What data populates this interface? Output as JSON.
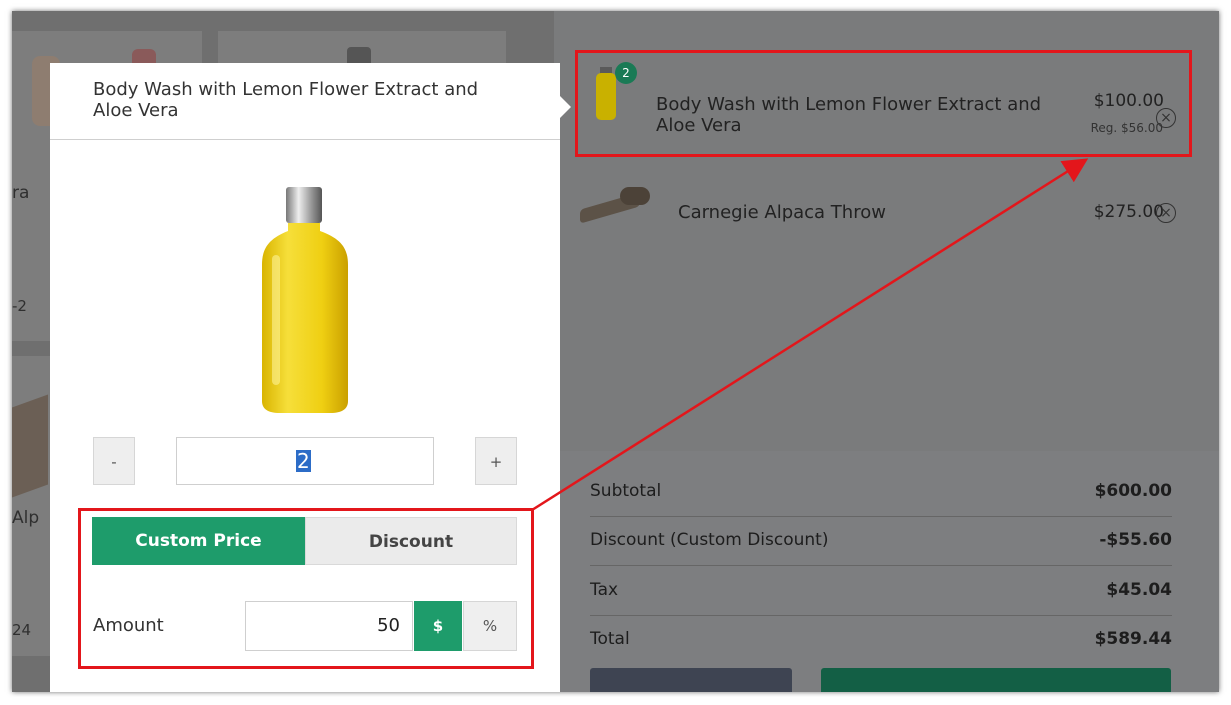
{
  "grid": {
    "partial_texts": [
      "ra",
      "-2",
      "Alp",
      "24"
    ]
  },
  "popup": {
    "title": "Body Wash with Lemon Flower Extract and Aloe Vera",
    "quantity": "2",
    "decrement_label": "-",
    "increment_label": "+",
    "tabs": {
      "custom_price": "Custom Price",
      "discount": "Discount"
    },
    "amount_label": "Amount",
    "amount_value": "50",
    "unit_dollar": "$",
    "unit_percent": "%"
  },
  "cart": {
    "items": [
      {
        "name": "Body Wash with Lemon Flower Extract and Aloe Vera",
        "price": "$100.00",
        "regular_price": "Reg. $56.00",
        "quantity_badge": "2",
        "remove_icon": "close-circle-icon"
      },
      {
        "name": "Carnegie Alpaca Throw",
        "price": "$275.00",
        "remove_icon": "close-circle-icon"
      }
    ],
    "totals": [
      {
        "label": "Subtotal",
        "value": "$600.00"
      },
      {
        "label": "Discount (Custom Discount)",
        "value": "-$55.60"
      },
      {
        "label": "Tax",
        "value": "$45.04"
      },
      {
        "label": "Total",
        "value": "$589.44"
      }
    ]
  },
  "colors": {
    "accent_green": "#1e9c6b",
    "highlight_red": "#e3161b",
    "selection_blue": "#2c6cc7"
  }
}
